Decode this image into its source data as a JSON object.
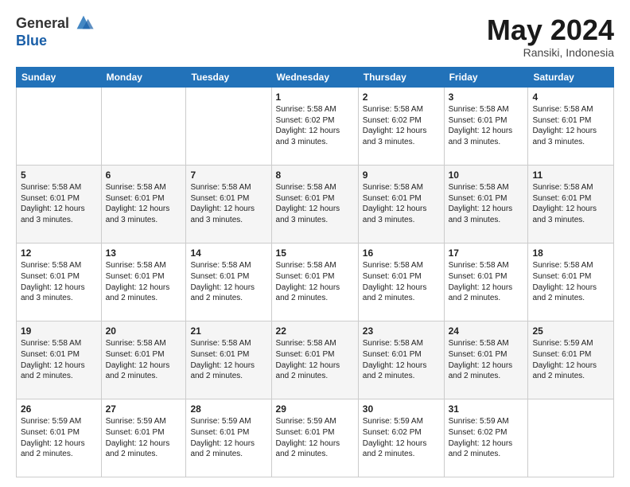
{
  "logo": {
    "general": "General",
    "blue": "Blue"
  },
  "header": {
    "title": "May 2024",
    "subtitle": "Ransiki, Indonesia"
  },
  "weekdays": [
    "Sunday",
    "Monday",
    "Tuesday",
    "Wednesday",
    "Thursday",
    "Friday",
    "Saturday"
  ],
  "weeks": [
    [
      {
        "day": "",
        "info": ""
      },
      {
        "day": "",
        "info": ""
      },
      {
        "day": "",
        "info": ""
      },
      {
        "day": "1",
        "info": "Sunrise: 5:58 AM\nSunset: 6:02 PM\nDaylight: 12 hours\nand 3 minutes."
      },
      {
        "day": "2",
        "info": "Sunrise: 5:58 AM\nSunset: 6:02 PM\nDaylight: 12 hours\nand 3 minutes."
      },
      {
        "day": "3",
        "info": "Sunrise: 5:58 AM\nSunset: 6:01 PM\nDaylight: 12 hours\nand 3 minutes."
      },
      {
        "day": "4",
        "info": "Sunrise: 5:58 AM\nSunset: 6:01 PM\nDaylight: 12 hours\nand 3 minutes."
      }
    ],
    [
      {
        "day": "5",
        "info": "Sunrise: 5:58 AM\nSunset: 6:01 PM\nDaylight: 12 hours\nand 3 minutes."
      },
      {
        "day": "6",
        "info": "Sunrise: 5:58 AM\nSunset: 6:01 PM\nDaylight: 12 hours\nand 3 minutes."
      },
      {
        "day": "7",
        "info": "Sunrise: 5:58 AM\nSunset: 6:01 PM\nDaylight: 12 hours\nand 3 minutes."
      },
      {
        "day": "8",
        "info": "Sunrise: 5:58 AM\nSunset: 6:01 PM\nDaylight: 12 hours\nand 3 minutes."
      },
      {
        "day": "9",
        "info": "Sunrise: 5:58 AM\nSunset: 6:01 PM\nDaylight: 12 hours\nand 3 minutes."
      },
      {
        "day": "10",
        "info": "Sunrise: 5:58 AM\nSunset: 6:01 PM\nDaylight: 12 hours\nand 3 minutes."
      },
      {
        "day": "11",
        "info": "Sunrise: 5:58 AM\nSunset: 6:01 PM\nDaylight: 12 hours\nand 3 minutes."
      }
    ],
    [
      {
        "day": "12",
        "info": "Sunrise: 5:58 AM\nSunset: 6:01 PM\nDaylight: 12 hours\nand 3 minutes."
      },
      {
        "day": "13",
        "info": "Sunrise: 5:58 AM\nSunset: 6:01 PM\nDaylight: 12 hours\nand 2 minutes."
      },
      {
        "day": "14",
        "info": "Sunrise: 5:58 AM\nSunset: 6:01 PM\nDaylight: 12 hours\nand 2 minutes."
      },
      {
        "day": "15",
        "info": "Sunrise: 5:58 AM\nSunset: 6:01 PM\nDaylight: 12 hours\nand 2 minutes."
      },
      {
        "day": "16",
        "info": "Sunrise: 5:58 AM\nSunset: 6:01 PM\nDaylight: 12 hours\nand 2 minutes."
      },
      {
        "day": "17",
        "info": "Sunrise: 5:58 AM\nSunset: 6:01 PM\nDaylight: 12 hours\nand 2 minutes."
      },
      {
        "day": "18",
        "info": "Sunrise: 5:58 AM\nSunset: 6:01 PM\nDaylight: 12 hours\nand 2 minutes."
      }
    ],
    [
      {
        "day": "19",
        "info": "Sunrise: 5:58 AM\nSunset: 6:01 PM\nDaylight: 12 hours\nand 2 minutes."
      },
      {
        "day": "20",
        "info": "Sunrise: 5:58 AM\nSunset: 6:01 PM\nDaylight: 12 hours\nand 2 minutes."
      },
      {
        "day": "21",
        "info": "Sunrise: 5:58 AM\nSunset: 6:01 PM\nDaylight: 12 hours\nand 2 minutes."
      },
      {
        "day": "22",
        "info": "Sunrise: 5:58 AM\nSunset: 6:01 PM\nDaylight: 12 hours\nand 2 minutes."
      },
      {
        "day": "23",
        "info": "Sunrise: 5:58 AM\nSunset: 6:01 PM\nDaylight: 12 hours\nand 2 minutes."
      },
      {
        "day": "24",
        "info": "Sunrise: 5:58 AM\nSunset: 6:01 PM\nDaylight: 12 hours\nand 2 minutes."
      },
      {
        "day": "25",
        "info": "Sunrise: 5:59 AM\nSunset: 6:01 PM\nDaylight: 12 hours\nand 2 minutes."
      }
    ],
    [
      {
        "day": "26",
        "info": "Sunrise: 5:59 AM\nSunset: 6:01 PM\nDaylight: 12 hours\nand 2 minutes."
      },
      {
        "day": "27",
        "info": "Sunrise: 5:59 AM\nSunset: 6:01 PM\nDaylight: 12 hours\nand 2 minutes."
      },
      {
        "day": "28",
        "info": "Sunrise: 5:59 AM\nSunset: 6:01 PM\nDaylight: 12 hours\nand 2 minutes."
      },
      {
        "day": "29",
        "info": "Sunrise: 5:59 AM\nSunset: 6:01 PM\nDaylight: 12 hours\nand 2 minutes."
      },
      {
        "day": "30",
        "info": "Sunrise: 5:59 AM\nSunset: 6:02 PM\nDaylight: 12 hours\nand 2 minutes."
      },
      {
        "day": "31",
        "info": "Sunrise: 5:59 AM\nSunset: 6:02 PM\nDaylight: 12 hours\nand 2 minutes."
      },
      {
        "day": "",
        "info": ""
      }
    ]
  ]
}
